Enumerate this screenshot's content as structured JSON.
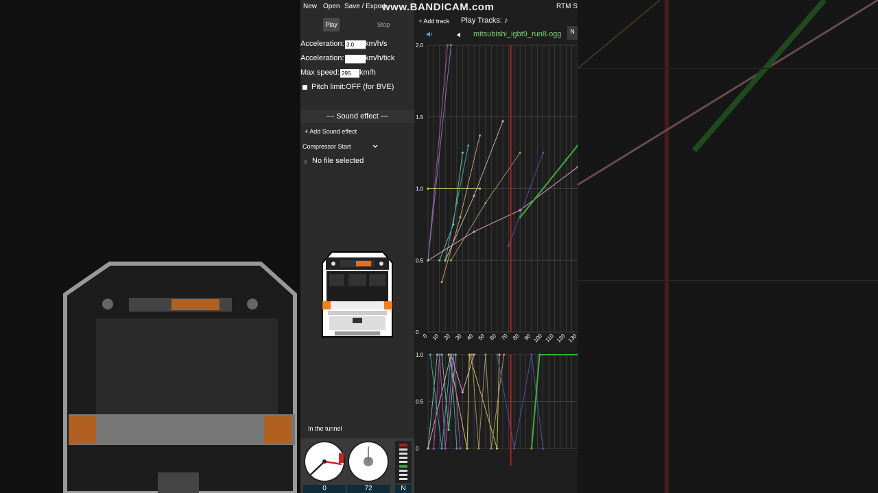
{
  "watermark": "www.BANDICAM.com",
  "menu": {
    "new": "New",
    "open": "Open",
    "save_export": "Save / Export",
    "title_fragment": "RTM S"
  },
  "controls": {
    "play": "Play",
    "stop": "Stop"
  },
  "settings": {
    "accel1_label": "Acceleration:",
    "accel1_value": "3.0",
    "accel1_unit": "km/h/s",
    "accel2_label": "Acceleration:",
    "accel2_value": "",
    "accel2_unit": "km/h/tick",
    "maxspeed_label": "Max speed:",
    "maxspeed_value": "295",
    "maxspeed_unit": "km/h",
    "pitch_label": "Pitch limit:OFF (for BVE)"
  },
  "sound_effect": {
    "header": "---   Sound effect   ---",
    "add_label": "+ Add Sound effect",
    "selected": "Compressor Start",
    "remove_icon": "x",
    "file_status": "No file selected"
  },
  "status": {
    "location": "In the tunnel"
  },
  "gauges": {
    "speed_value": "0",
    "secondary_value": "72",
    "notch_value": "N"
  },
  "tracks": {
    "add_label": "+ Add track",
    "play_tracks_label": "Play Tracks: ♪",
    "current_file": "mitsubishi_igbt9_run8.ogg",
    "next_btn": "N"
  },
  "icons": {
    "speaker": "speaker-icon",
    "prev": "prev-arrow-icon",
    "checkbox": "checkbox-icon",
    "dropdown": "chevron-down-icon"
  },
  "colors": {
    "accent_green": "#7fd17f",
    "cursor_red": "#cc2222",
    "orange": "#f08020"
  },
  "chart_data": [
    {
      "type": "line",
      "title": "",
      "xlabel": "",
      "ylabel": "",
      "x_ticks": [
        "0",
        "10",
        "20",
        "30",
        "40",
        "50",
        "60",
        "70",
        "80",
        "90",
        "100",
        "110",
        "120",
        "130"
      ],
      "y_ticks": [
        "0",
        "0.5",
        "1.0",
        "1.5",
        "2.0"
      ],
      "xlim": [
        0,
        130
      ],
      "ylim": [
        0,
        2.0
      ],
      "cursor_x": 72,
      "series": [
        {
          "color": "#b050b0",
          "x": [
            0,
            17
          ],
          "y": [
            0.5,
            2.0
          ]
        },
        {
          "color": "#7a7ab0",
          "x": [
            0,
            20
          ],
          "y": [
            0.5,
            2.0
          ]
        },
        {
          "color": "#6abf8a",
          "x": [
            10,
            22,
            30
          ],
          "y": [
            0.5,
            0.75,
            1.25
          ]
        },
        {
          "color": "#4aa0b0",
          "x": [
            15,
            25,
            35
          ],
          "y": [
            0.5,
            0.9,
            1.3
          ]
        },
        {
          "color": "#c0a070",
          "x": [
            12,
            28,
            45
          ],
          "y": [
            0.35,
            0.8,
            1.37
          ]
        },
        {
          "color": "#c8c060",
          "x": [
            0,
            45
          ],
          "y": [
            1.0,
            1.0
          ]
        },
        {
          "color": "#c0b0a0",
          "x": [
            15,
            40,
            65
          ],
          "y": [
            0.5,
            0.95,
            1.47
          ]
        },
        {
          "color": "#a09060",
          "x": [
            20,
            50,
            80
          ],
          "y": [
            0.5,
            0.9,
            1.25
          ]
        },
        {
          "color": "#e0a0c0",
          "x": [
            0,
            40,
            80,
            130
          ],
          "y": [
            0.5,
            0.7,
            0.85,
            1.15
          ]
        },
        {
          "color": "#3cb03c",
          "x": [
            80,
            120,
            130
          ],
          "y": [
            0.8,
            1.2,
            1.3
          ]
        },
        {
          "color": "#5050a0",
          "x": [
            70,
            100
          ],
          "y": [
            0.6,
            1.25
          ]
        }
      ]
    },
    {
      "type": "line",
      "title": "",
      "x_ticks": [],
      "y_ticks": [
        "0",
        "0.5",
        "1.0"
      ],
      "xlim": [
        0,
        130
      ],
      "ylim": [
        0,
        1.0
      ],
      "cursor_x": 72,
      "series": [
        {
          "color": "#6abf8a",
          "x": [
            0,
            8,
            12,
            18,
            24
          ],
          "y": [
            0,
            1.0,
            1.0,
            0.2,
            1.0
          ]
        },
        {
          "color": "#e0a0c0",
          "x": [
            0,
            20,
            30,
            40
          ],
          "y": [
            0,
            1.0,
            0.6,
            1.0
          ]
        },
        {
          "color": "#c8c060",
          "x": [
            18,
            34,
            36,
            60,
            62
          ],
          "y": [
            1.0,
            0,
            1.0,
            0,
            1.0
          ]
        },
        {
          "color": "#b050b0",
          "x": [
            5,
            10,
            15,
            22,
            28
          ],
          "y": [
            0,
            1.0,
            0,
            1.0,
            0
          ]
        },
        {
          "color": "#4aa0b0",
          "x": [
            2,
            12,
            20,
            25
          ],
          "y": [
            1.0,
            0,
            1.0,
            0
          ]
        },
        {
          "color": "#a09060",
          "x": [
            38,
            44,
            50,
            55,
            66
          ],
          "y": [
            1.0,
            0,
            1.0,
            0,
            1.0
          ]
        },
        {
          "color": "#5050a0",
          "x": [
            60,
            75,
            90,
            100
          ],
          "y": [
            1.0,
            0,
            1.0,
            0
          ]
        },
        {
          "color": "#3cb03c",
          "x": [
            90,
            97,
            130
          ],
          "y": [
            0,
            1.0,
            1.0
          ]
        }
      ]
    }
  ]
}
